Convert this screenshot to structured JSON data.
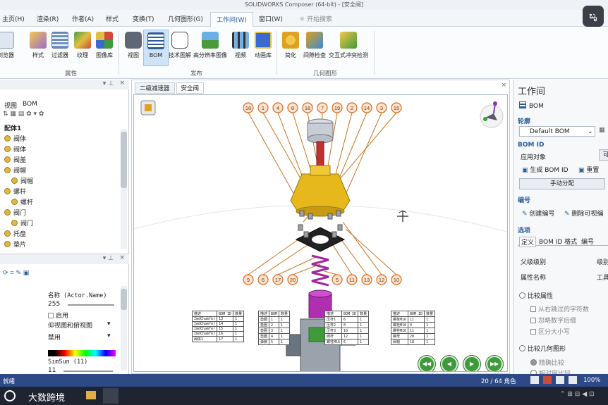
{
  "window": {
    "title": "SOLIDWORKS Composer (64-bit) - [安全阀]"
  },
  "menu_tabs": [
    "主页(H)",
    "渲染(R)",
    "作者(A)",
    "样式",
    "变换(T)",
    "几何图形(G)",
    "工作间(W)",
    "窗口(W)"
  ],
  "search": {
    "placeholder": "开始搜索"
  },
  "user_badge": "ಬೃ",
  "ribbon": {
    "buttons": [
      "浏览器",
      "样式",
      "过滤器",
      "纹理",
      "图像库",
      "视图",
      "BOM",
      "技术图解",
      "高分辨率图像",
      "视频",
      "动画库",
      "简化",
      "间隙检查",
      "交互式冲突检测"
    ],
    "groups": [
      "属性",
      "发布",
      "几何图形"
    ]
  },
  "left_panel": {
    "tabs": [
      "视图",
      "BOM"
    ],
    "root": "配体1",
    "items": [
      "阀体",
      "阀体",
      "阀盖",
      "阀帽",
      "阀帽",
      "螺杆",
      "螺杆",
      "阀门",
      "阀门",
      "托盘",
      "垫片"
    ]
  },
  "props_panel": {
    "name_label": "名称 (Actor.Name)",
    "value_255": "255",
    "enabled_label": "启用",
    "view_label": "仰视图和俯视图",
    "disabled_label": "禁用",
    "font_label": "SimSun (11)",
    "size_value": "11"
  },
  "viewport": {
    "tabs": [
      "二级减速器",
      "安全阀"
    ],
    "top_balloons": [
      "16",
      "1",
      "4",
      "8",
      "18",
      "7",
      "19",
      "2",
      "14",
      "3",
      "15"
    ],
    "bottom_balloons": [
      "9",
      "6",
      "17",
      "20",
      "5",
      "11",
      "13",
      "12",
      "10"
    ],
    "bom_tables": [
      {
        "headers": [
          "描述",
          "BOM ID",
          "数量"
        ],
        "rows": [
          [
            "ImdChamfer",
            "13",
            "1"
          ],
          [
            "ImdChamfer",
            "14",
            "1"
          ],
          [
            "ImdChamfer",
            "15",
            "1"
          ],
          [
            "ImdChamfer",
            "16",
            "1"
          ],
          [
            "阀体1",
            "17",
            "1"
          ]
        ]
      },
      {
        "headers": [
          "描述",
          "BOM",
          "数量"
        ],
        "rows": [
          [
            "垫圈",
            "1",
            "1"
          ],
          [
            "垫圈",
            "2",
            "1"
          ],
          [
            "垫圈",
            "3",
            "1"
          ],
          [
            "垫圈",
            "4",
            "1"
          ],
          [
            "弹簧",
            "5",
            "1"
          ]
        ]
      },
      {
        "headers": [
          "描述",
          "BOM ID",
          "数量"
        ],
        "rows": [
          [
            "压杆1",
            "6",
            "1"
          ],
          [
            "压杆2",
            "8",
            "1"
          ],
          [
            "压杆3",
            "10",
            "1"
          ],
          [
            "阀杆",
            "12",
            "1"
          ],
          [
            "螺柱M16",
            "6",
            "1"
          ]
        ]
      },
      {
        "headers": [
          "描述",
          "BOM ID",
          "数量"
        ],
        "rows": [
          [
            "螺栓M16",
            "11",
            "1"
          ],
          [
            "螺栓M16",
            "9",
            "1"
          ],
          [
            "螺栓M16",
            "11",
            "1"
          ],
          [
            "螺母",
            "20",
            "1"
          ],
          [
            "阀帽",
            "18",
            "1"
          ]
        ]
      }
    ]
  },
  "right_panel": {
    "title": "工作间",
    "bom_label": "BOM",
    "outline_label": "轮廓",
    "outline_value": "Default BOM",
    "bom_id_section": "BOM ID",
    "apply_label": "应用对象",
    "generate_label": "生成 BOM ID",
    "reset_label": "重置",
    "manual_button": "手动分配",
    "numbering_section": "编号",
    "create_label": "创建编号",
    "delete_label": "删除可视编",
    "options_section": "选项",
    "option_tabs": [
      "定义",
      "BOM ID 格式",
      "编号"
    ],
    "parent_level_label": "父级级别",
    "parent_level_value": "级别",
    "attr_name_label": "属性名称",
    "attr_name_value": "工具",
    "compare_attr_label": "比较属性",
    "from_right_label": "从右跳过的字符数",
    "ignore_after_label": "忽略数字后缀",
    "case_label": "区分大小写",
    "compare_geom_label": "比较几何图形",
    "exact_label": "精确比较",
    "relative_label": "相对度比较"
  },
  "status": {
    "left": "就绪",
    "count": "20 / 64 角色",
    "zoom": "100%"
  },
  "taskbar": {
    "brand": "大数跨境"
  },
  "colors": {
    "accent": "#2a5d9a",
    "balloon": "#d96a1f",
    "leader": "#c8741f",
    "yellow_part": "#e6b81c",
    "purple_part": "#b02fb0",
    "nav_green": "#3e9a3a"
  }
}
